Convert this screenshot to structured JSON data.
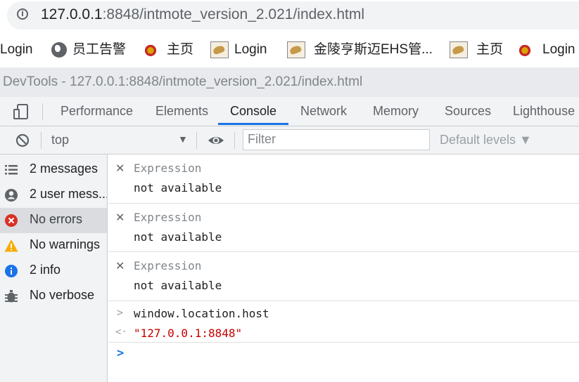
{
  "address": {
    "url_host": "127.0.0.1",
    "url_rest": ":8848/intmote_version_2.021/index.html"
  },
  "bookmarks": [
    {
      "label": "Login",
      "icon": "none"
    },
    {
      "label": "员工告警",
      "icon": "globe-icon"
    },
    {
      "label": "主页",
      "icon": "badge-icon"
    },
    {
      "label": "Login",
      "icon": "tomcat-icon"
    },
    {
      "label": "金陵亨斯迈EHS管...",
      "icon": "tomcat-icon"
    },
    {
      "label": "主页",
      "icon": "tomcat-icon"
    },
    {
      "label": "Login",
      "icon": "badge-icon"
    }
  ],
  "devtools": {
    "title": "DevTools - 127.0.0.1:8848/intmote_version_2.021/index.html",
    "tabs": [
      "Performance",
      "Elements",
      "Console",
      "Network",
      "Memory",
      "Sources",
      "Lighthouse"
    ],
    "active_tab": "Console",
    "toolbar": {
      "context": "top",
      "filter_placeholder": "Filter",
      "levels": "Default levels ▼"
    }
  },
  "sidebar": [
    {
      "label": "2 messages",
      "icon": "list-icon"
    },
    {
      "label": "2 user mess...",
      "icon": "user-icon"
    },
    {
      "label": "No errors",
      "icon": "error-icon",
      "selected": true
    },
    {
      "label": "No warnings",
      "icon": "warning-icon"
    },
    {
      "label": "2 info",
      "icon": "info-icon"
    },
    {
      "label": "No verbose",
      "icon": "bug-icon"
    }
  ],
  "expressions": [
    {
      "label": "Expression",
      "value": "not available"
    },
    {
      "label": "Expression",
      "value": "not available"
    },
    {
      "label": "Expression",
      "value": "not available"
    }
  ],
  "console": {
    "input": "window.location.host",
    "output": "\"127.0.0.1:8848\"",
    "colors": {
      "string": "#c80000",
      "prompt": "#1a73e8"
    }
  }
}
